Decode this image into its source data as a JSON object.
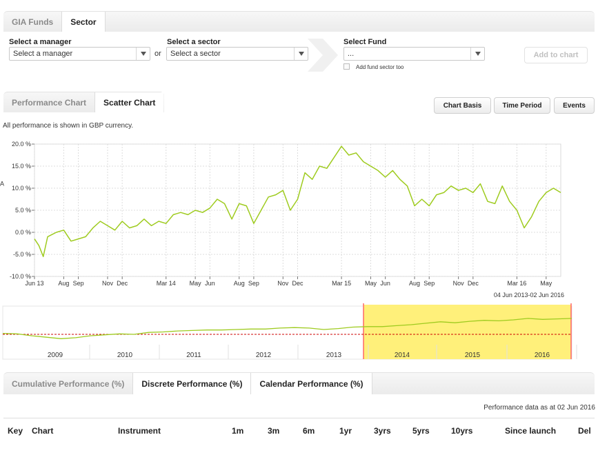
{
  "top_tabs": [
    {
      "label": "GIA Funds",
      "active": false
    },
    {
      "label": "Sector",
      "active": true
    }
  ],
  "selectors": {
    "manager": {
      "label": "Select a manager",
      "value": "Select a manager"
    },
    "or_text": "or",
    "sector": {
      "label": "Select a sector",
      "value": "Select a sector"
    },
    "fund": {
      "label": "Select Fund",
      "value": "..."
    },
    "add_fund_sector": {
      "label": "Add fund sector too",
      "checked": false
    },
    "add_to_chart": "Add to chart"
  },
  "chart_tabs": [
    {
      "label": "Performance Chart",
      "active": false
    },
    {
      "label": "Scatter Chart",
      "active": true
    }
  ],
  "chart_buttons": {
    "basis": "Chart Basis",
    "period": "Time Period",
    "events": "Events"
  },
  "currency_note": "All performance is shown in GBP currency.",
  "colors": {
    "series": "#9ecb1e",
    "navigator_band": "#fff07a",
    "zero_line": "#cc0000",
    "range_edge": "#ff6666"
  },
  "chart_data": {
    "type": "line",
    "y_ticks": [
      "20.0 %",
      "15.0 %",
      "10.0 %",
      "5.0 %",
      "0.0 %",
      "-5.0 %",
      "-10.0 %"
    ],
    "y_values": [
      20,
      15,
      10,
      5,
      0,
      -5,
      -10
    ],
    "ylim": [
      -10,
      20
    ],
    "x_ticks": [
      "Jun 13",
      "Aug",
      "Sep",
      "Nov",
      "Dec",
      "Mar 14",
      "May",
      "Jun",
      "Aug",
      "Sep",
      "Nov",
      "Dec",
      "Mar 15",
      "May",
      "Jun",
      "Aug",
      "Sep",
      "Nov",
      "Dec",
      "Mar 16",
      "May"
    ],
    "x_tick_months": [
      0,
      2,
      3,
      5,
      6,
      9,
      11,
      12,
      14,
      15,
      17,
      18,
      21,
      23,
      24,
      26,
      27,
      29,
      30,
      33,
      35
    ],
    "x_months": [
      0,
      0.3,
      0.6,
      0.9,
      1.2,
      1.5,
      2,
      2.5,
      3,
      3.5,
      4,
      4.5,
      5,
      5.5,
      6,
      6.5,
      7,
      7.5,
      8,
      8.5,
      9,
      9.5,
      10,
      10.5,
      11,
      11.5,
      12,
      12.5,
      13,
      13.5,
      14,
      14.5,
      15,
      15.5,
      16,
      16.5,
      17,
      17.5,
      18,
      18.5,
      19,
      19.5,
      20,
      20.5,
      21,
      21.5,
      22,
      22.5,
      23,
      23.5,
      24,
      24.5,
      25,
      25.5,
      26,
      26.5,
      27,
      27.5,
      28,
      28.5,
      29,
      29.5,
      30,
      30.5,
      31,
      31.5,
      32,
      32.5,
      33,
      33.5,
      34,
      34.5,
      35,
      35.5,
      36
    ],
    "series": [
      {
        "name": "A",
        "values": [
          -1.5,
          -3,
          -5.5,
          -1,
          -0.5,
          0,
          0.5,
          -2,
          -1.5,
          -1,
          1,
          2.5,
          1.5,
          0.5,
          2.5,
          1,
          1.5,
          3,
          1.5,
          2.5,
          2,
          4,
          4.5,
          4,
          5,
          4.5,
          5.5,
          7.5,
          6.5,
          3,
          6.5,
          6,
          2,
          5,
          8,
          8.5,
          9.5,
          5,
          7.5,
          13.5,
          12,
          15,
          14.5,
          17,
          19.5,
          17.5,
          18,
          16,
          15,
          14,
          12.5,
          14,
          12,
          10.5,
          6,
          7.5,
          6,
          8.5,
          9,
          10.5,
          9.5,
          10,
          9,
          11,
          7,
          6.5,
          10.5,
          7,
          5,
          1,
          3.5,
          7,
          9,
          10,
          9,
          11,
          8.5,
          7.5,
          8.5,
          9
        ]
      }
    ],
    "series_end_label": "A",
    "date_range": "04 Jun 2013-02 Jun 2016"
  },
  "navigator": {
    "year_labels": [
      "2009",
      "2010",
      "2011",
      "2012",
      "2013",
      "2014",
      "2015",
      "2016"
    ],
    "values": [
      0.2,
      0.1,
      -0.3,
      -0.6,
      -0.9,
      -0.7,
      -0.3,
      -0.1,
      0.1,
      0.0,
      0.4,
      0.5,
      0.7,
      0.8,
      0.9,
      0.9,
      1.0,
      1.1,
      1.1,
      1.3,
      1.4,
      1.3,
      1.0,
      1.2,
      1.5,
      1.6,
      1.6,
      1.8,
      2.0,
      2.3,
      2.6,
      2.4,
      2.7,
      2.9,
      2.8,
      3.0,
      3.3,
      3.1,
      3.2,
      3.3
    ]
  },
  "perf_tabs": [
    {
      "label": "Cumulative Performance (%)",
      "active": false
    },
    {
      "label": "Discrete Performance (%)",
      "active": true
    },
    {
      "label": "Calendar Performance (%)",
      "active": true
    }
  ],
  "perf_as_at": "Performance data as at 02 Jun 2016",
  "table_headers": [
    "Key",
    "Chart",
    "Instrument",
    "1m",
    "3m",
    "6m",
    "1yr",
    "3yrs",
    "5yrs",
    "10yrs",
    "Since launch",
    "Del"
  ]
}
